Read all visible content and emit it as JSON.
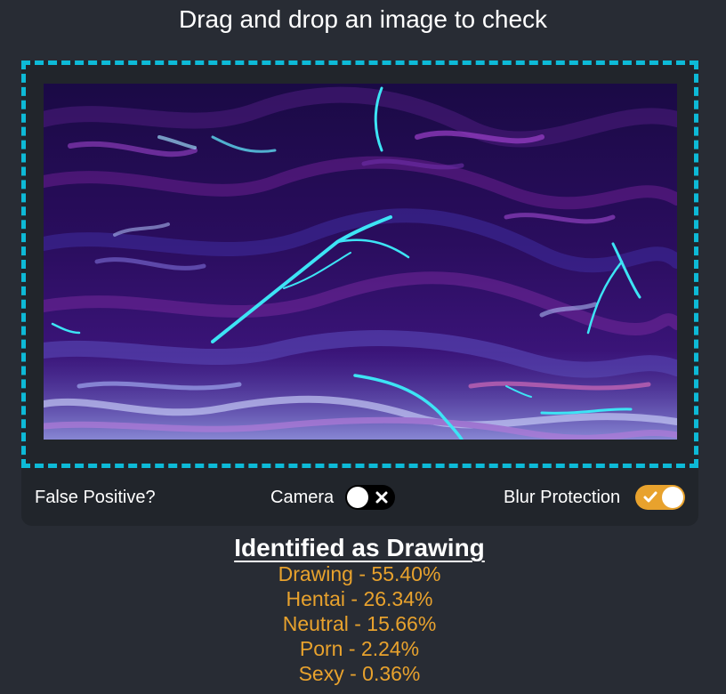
{
  "header": {
    "title": "Drag and drop an image to check"
  },
  "dropzone": {
    "border_color": "#0dbad7",
    "preview_image": "abstract purple and cyan swirling painting"
  },
  "controls": {
    "false_positive_label": "False Positive?",
    "camera_label": "Camera",
    "camera_enabled": false,
    "blur_label": "Blur Protection",
    "blur_enabled": true,
    "accent_color": "#e8a22d"
  },
  "result": {
    "title": "Identified as Drawing",
    "items": [
      "Drawing - 55.40%",
      "Hentai - 26.34%",
      "Neutral - 15.66%",
      "Porn - 2.24%",
      "Sexy - 0.36%"
    ]
  },
  "colors": {
    "background": "#282c34",
    "card": "#21252b",
    "result_text": "#e8a22d"
  }
}
